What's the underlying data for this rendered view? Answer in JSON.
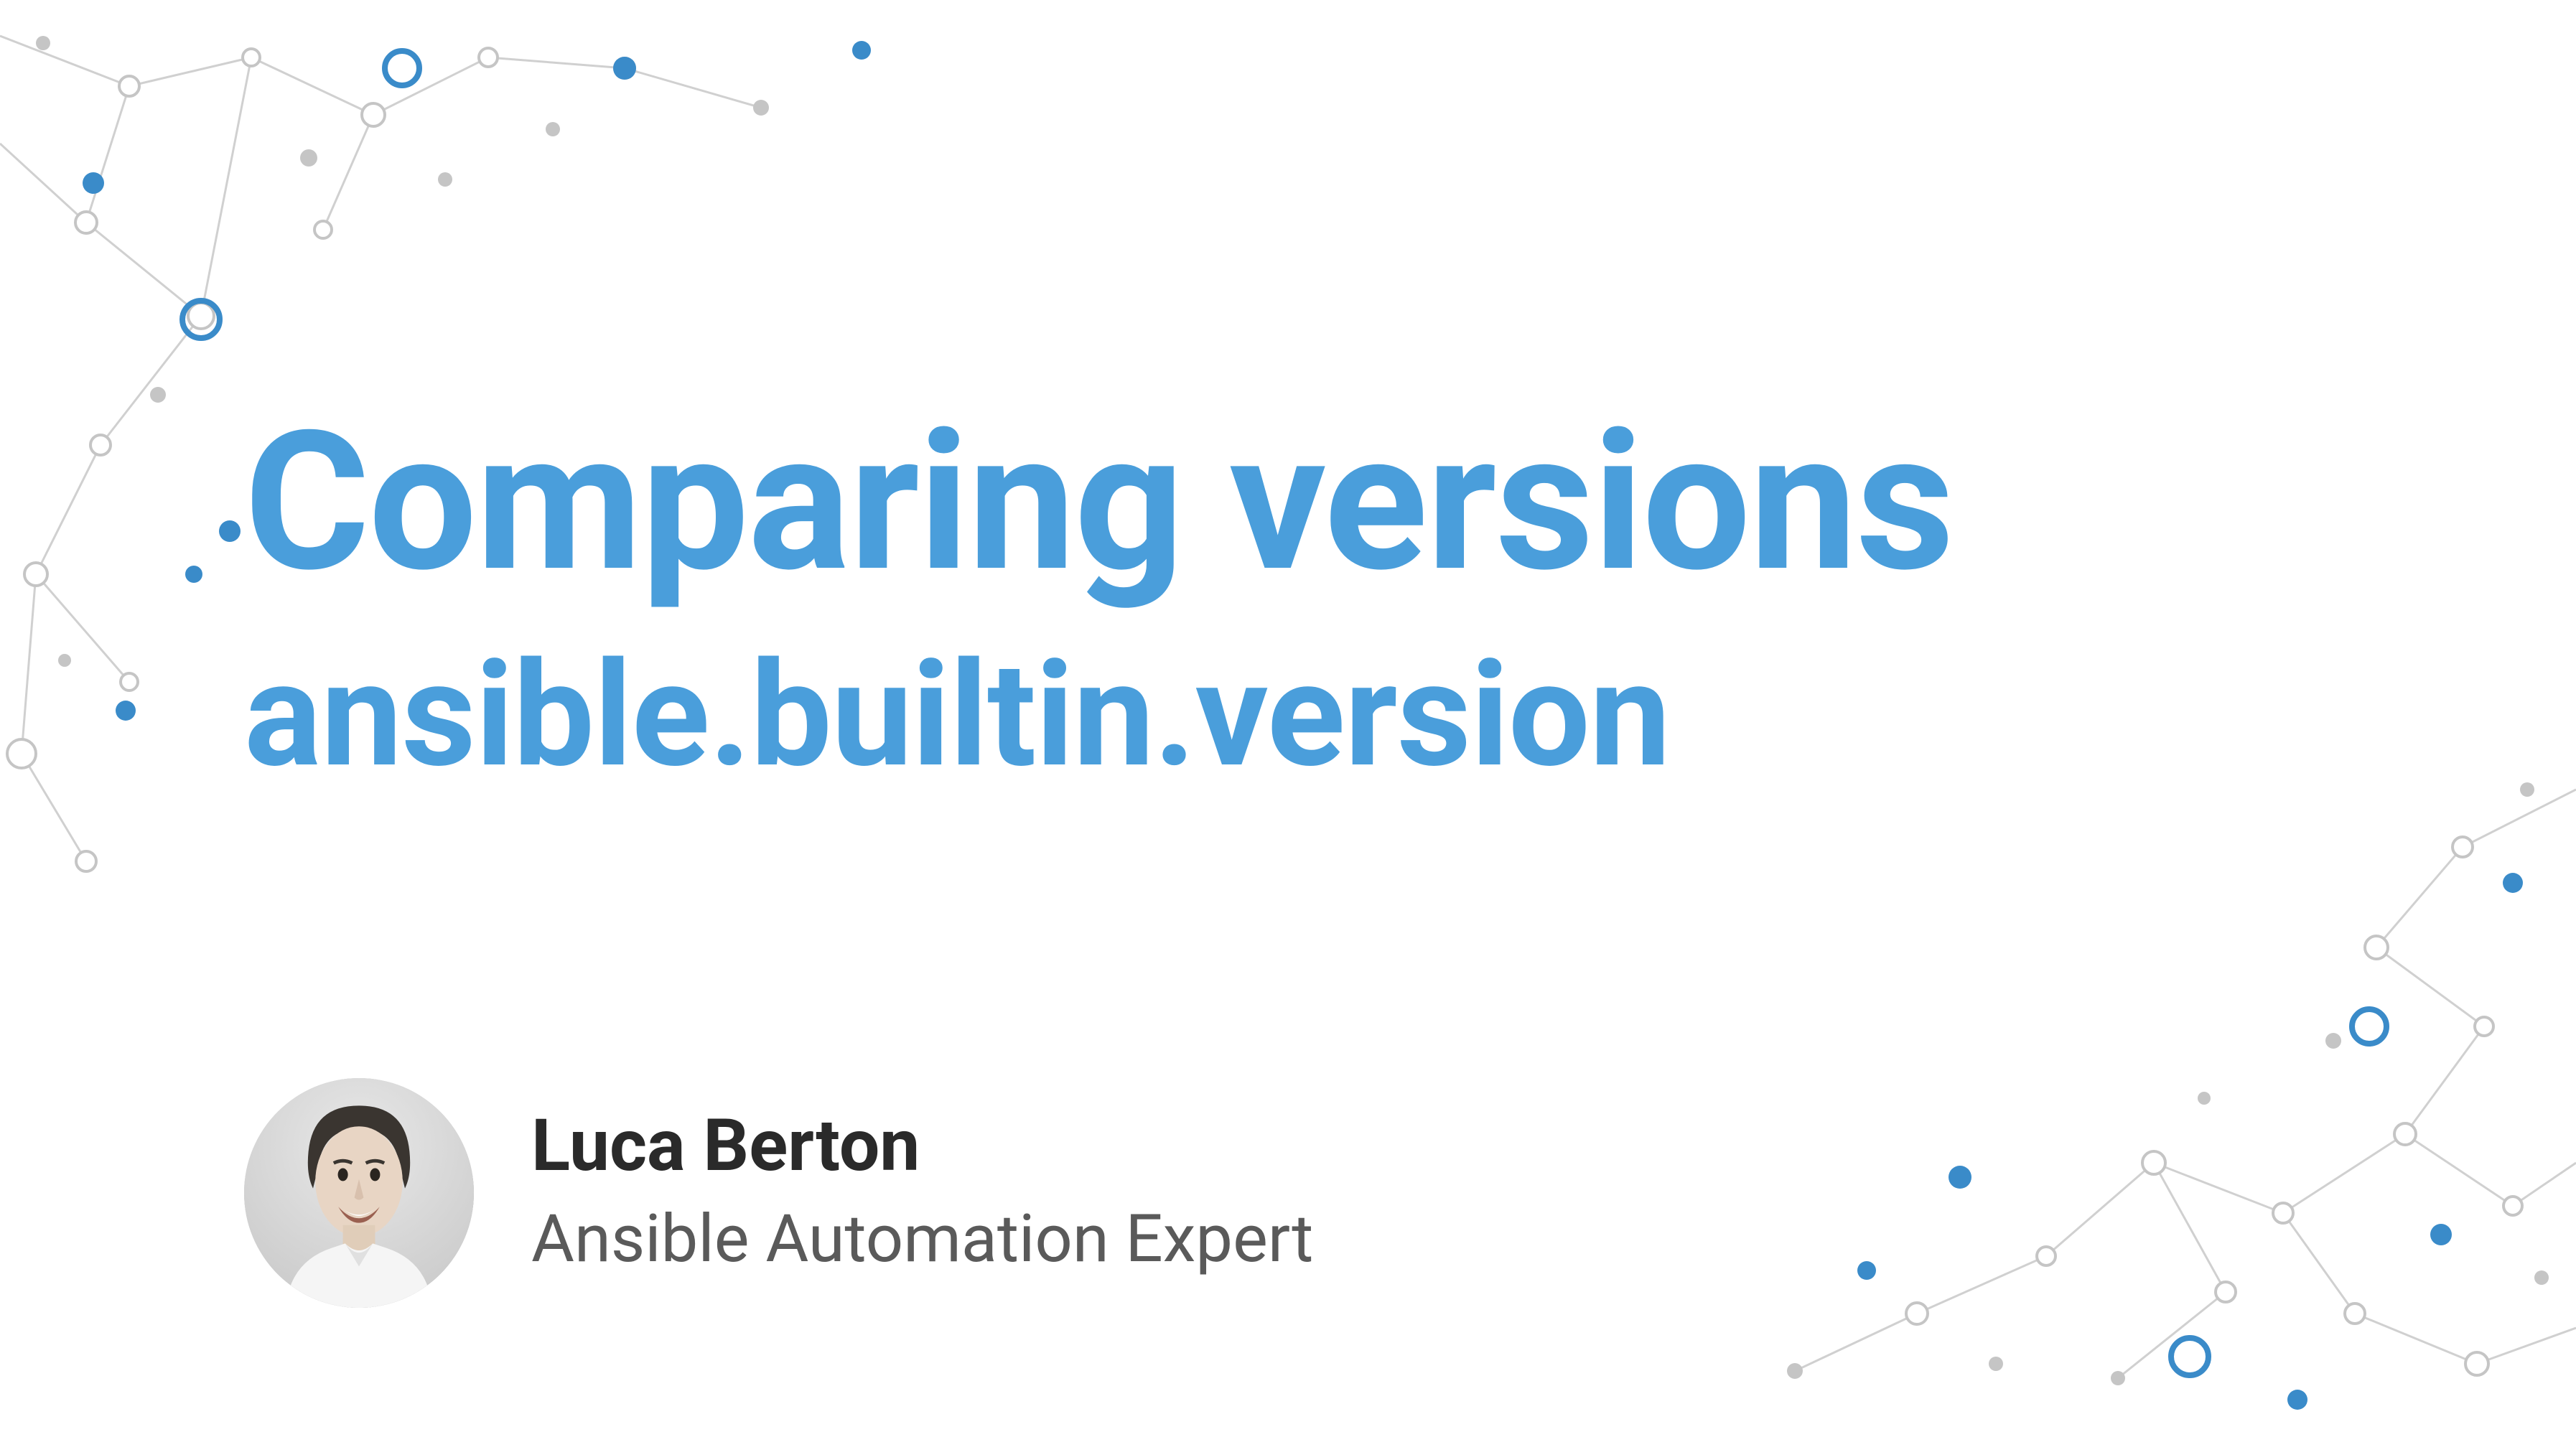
{
  "slide": {
    "title": "Comparing versions",
    "subtitle": "ansible.builtin.version"
  },
  "author": {
    "name": "Luca Berton",
    "title": "Ansible Automation Expert"
  },
  "colors": {
    "accent": "#4a9edb",
    "text_primary": "#2a2a2a",
    "text_secondary": "#5a5a5a",
    "network_gray": "#c5c5c5",
    "network_blue": "#3a8bc9"
  }
}
